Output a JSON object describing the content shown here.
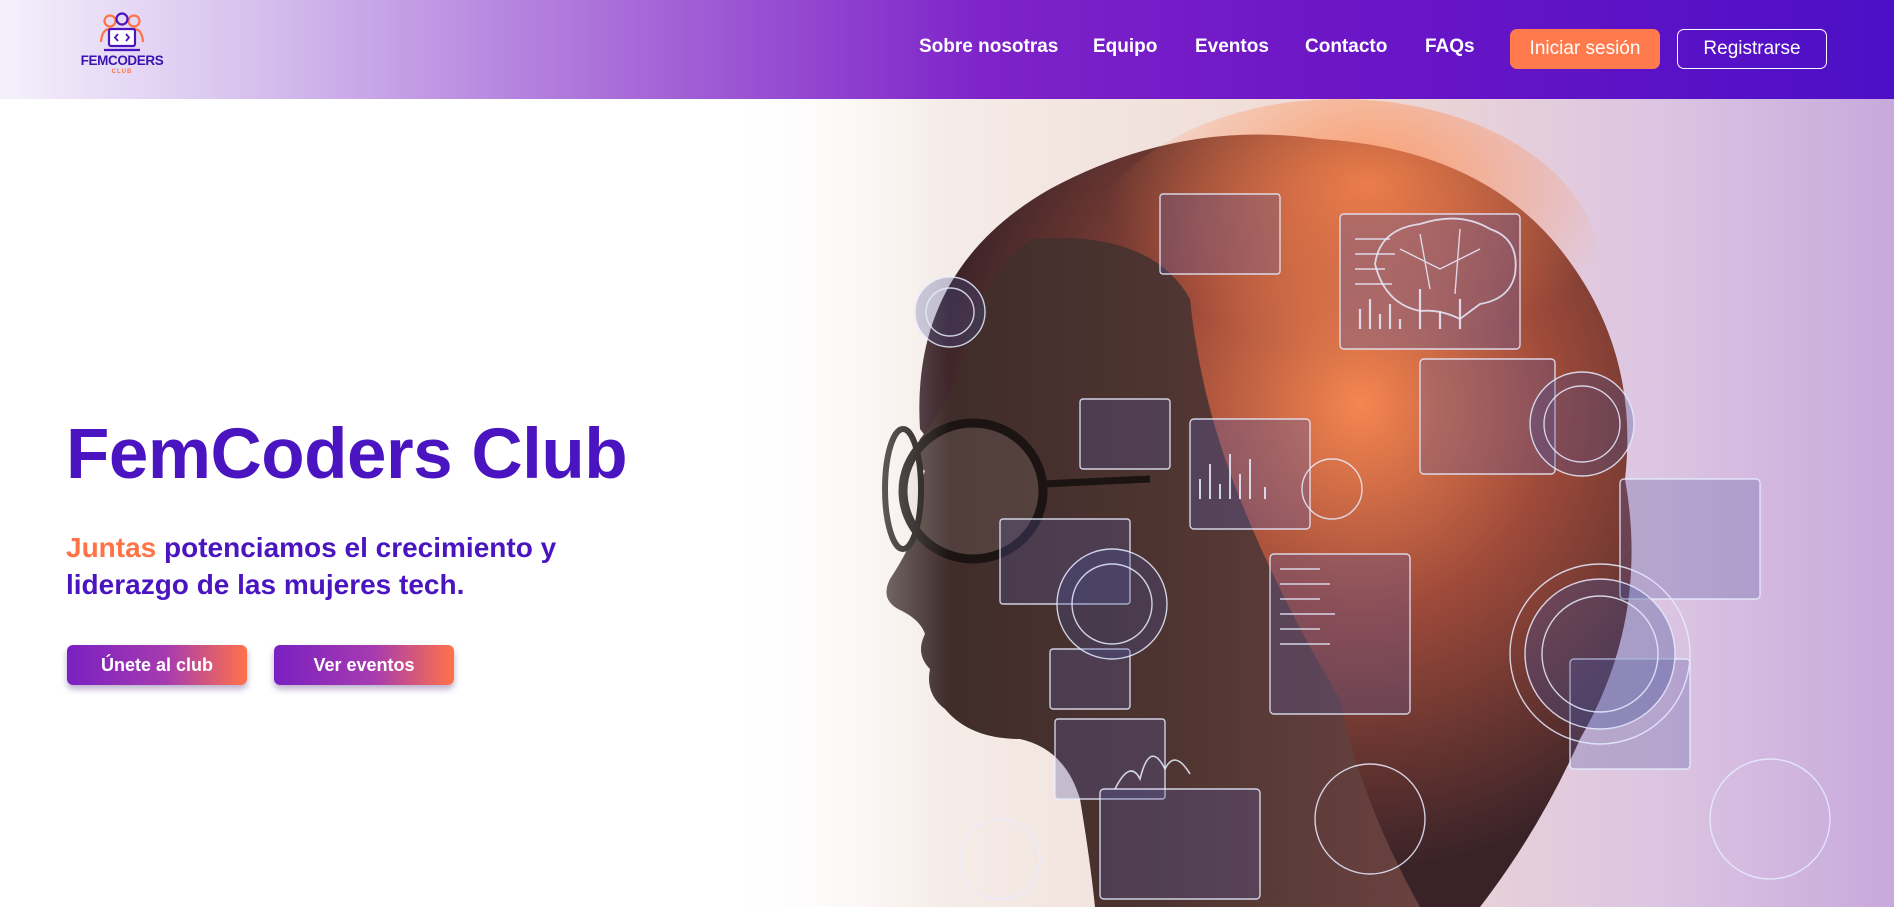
{
  "brand": {
    "logo_text": "FEMCODERS",
    "logo_sub": "CLUB",
    "colors": {
      "primary": "#4a14c0",
      "accent": "#ff7347",
      "purple": "#7a20c2"
    }
  },
  "nav": {
    "links": [
      {
        "label": "Sobre nosotras"
      },
      {
        "label": "Equipo"
      },
      {
        "label": "Eventos"
      },
      {
        "label": "Contacto"
      },
      {
        "label": "FAQs"
      }
    ],
    "login_label": "Iniciar sesión",
    "register_label": "Registrarse"
  },
  "hero": {
    "title": "FemCoders Club",
    "subtitle_accent": "Juntas",
    "subtitle_rest": " potenciamos el crecimiento y liderazgo de las mujeres tech.",
    "cta_join": "Únete al club",
    "cta_events": "Ver eventos",
    "image": "woman-profile-with-tech-overlay"
  }
}
